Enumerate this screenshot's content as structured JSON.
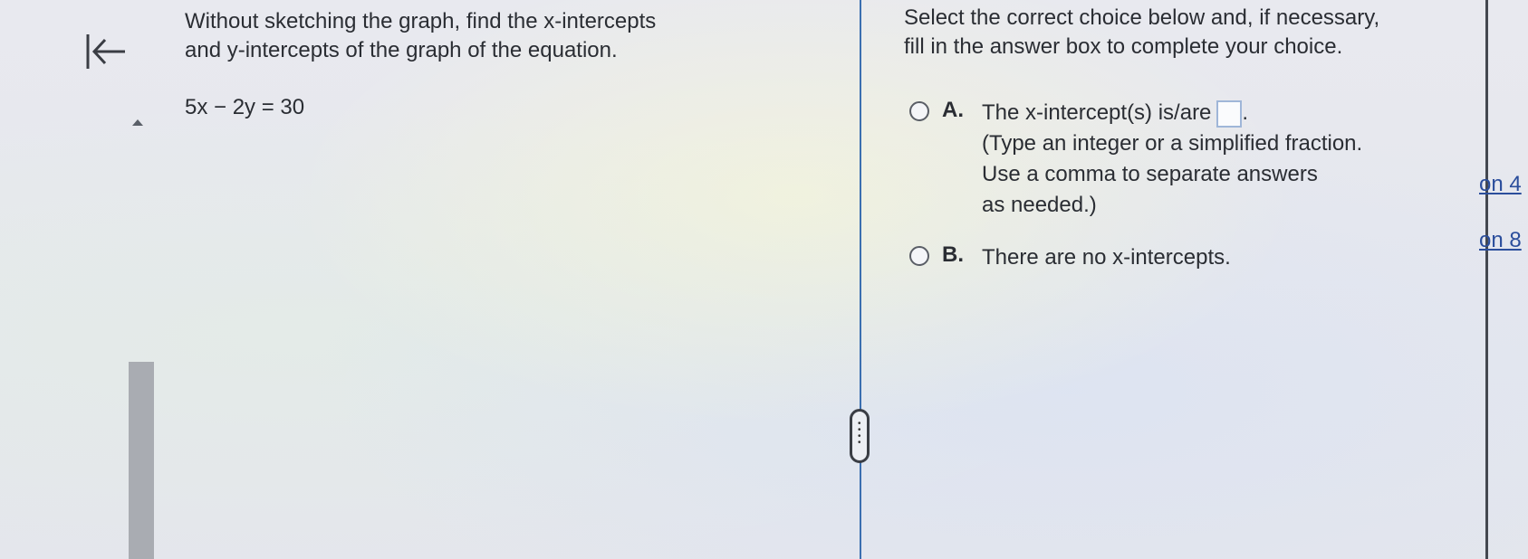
{
  "nav": {
    "back_icon": "back-to-start-icon"
  },
  "question": {
    "line1": "Without sketching the graph, find the x-intercepts",
    "line2": "and y-intercepts of the graph of the equation.",
    "equation": "5x − 2y = 30"
  },
  "answer": {
    "instruction_line1": "Select the correct choice below and, if necessary,",
    "instruction_line2": "fill in the answer box to complete your choice.",
    "choices": [
      {
        "letter": "A.",
        "text_before_box": "The x-intercept(s) is/are",
        "text_after_box": ".",
        "hint_line1": "(Type an integer or a simplified fraction.",
        "hint_line2": "Use a comma to separate answers",
        "hint_line3": "as needed.)"
      },
      {
        "letter": "B.",
        "text": "There are no x-intercepts."
      }
    ]
  },
  "side_panel": {
    "link1": "on 4",
    "link2": "on 8"
  },
  "colors": {
    "divider": "#3b6fb0",
    "link": "#2b4e9c",
    "answer_box_border": "#9fb6d8"
  }
}
